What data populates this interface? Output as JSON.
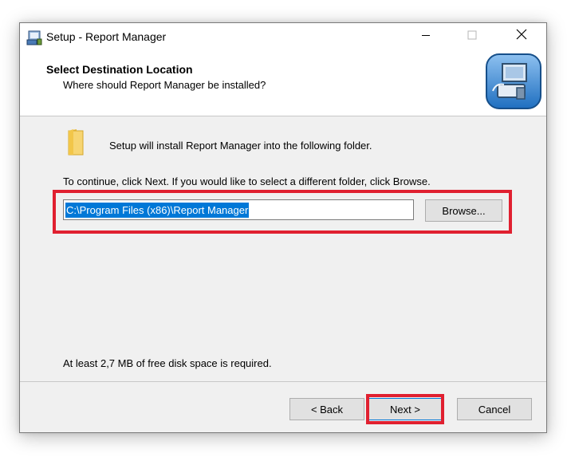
{
  "window": {
    "title": "Setup - Report Manager"
  },
  "titlebar": {
    "minimize_icon": "minimize-icon",
    "maximize_icon": "maximize-icon",
    "close_icon": "close-icon"
  },
  "header": {
    "title": "Select Destination Location",
    "subtitle": "Where should Report Manager be installed?",
    "image_icon": "computer-install-icon"
  },
  "body": {
    "folder_icon": "folder-icon",
    "intro": "Setup will install Report Manager into the following folder.",
    "instruction": "To continue, click Next. If you would like to select a different folder, click Browse.",
    "path_value": "C:\\Program Files (x86)\\Report Manager",
    "browse_label": "Browse...",
    "disk_space": "At least 2,7 MB of free disk space is required."
  },
  "footer": {
    "back_label": "< Back",
    "next_label": "Next >",
    "cancel_label": "Cancel"
  },
  "colors": {
    "highlight": "#e02030",
    "selection": "#0078d7",
    "dialog_bg": "#f0f0f0"
  }
}
